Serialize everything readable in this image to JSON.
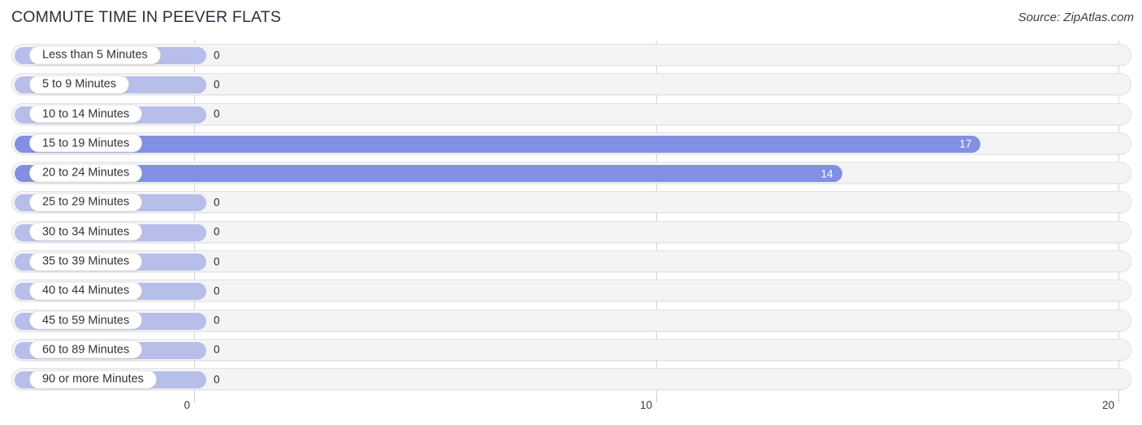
{
  "header": {
    "title": "COMMUTE TIME IN PEEVER FLATS",
    "source": "Source: ZipAtlas.com"
  },
  "colors": {
    "bar_fill": "#8190e2",
    "bar_zero_fill": "#b7beea",
    "track_bg": "#f4f4f6",
    "gridline": "#d6d6d6",
    "label_bg": "#ffffff",
    "value_inside_text": "#ffffff",
    "value_outside_text": "#2b2b2b",
    "title_text": "#2b2f3a"
  },
  "chart_data": {
    "type": "bar",
    "orientation": "horizontal",
    "title": "COMMUTE TIME IN PEEVER FLATS",
    "subtitle": "",
    "xlabel": "",
    "ylabel": "",
    "xlim": [
      0,
      20
    ],
    "grid": true,
    "legend": null,
    "source": "Source: ZipAtlas.com",
    "x_ticks": [
      "0",
      "10",
      "20"
    ],
    "x_tick_values": [
      0,
      10,
      20
    ],
    "categories": [
      "Less than 5 Minutes",
      "5 to 9 Minutes",
      "10 to 14 Minutes",
      "15 to 19 Minutes",
      "20 to 24 Minutes",
      "25 to 29 Minutes",
      "30 to 34 Minutes",
      "35 to 39 Minutes",
      "40 to 44 Minutes",
      "45 to 59 Minutes",
      "60 to 89 Minutes",
      "90 or more Minutes"
    ],
    "values": [
      0,
      0,
      0,
      17,
      14,
      0,
      0,
      0,
      0,
      0,
      0,
      0
    ],
    "value_labels": [
      "0",
      "0",
      "0",
      "17",
      "14",
      "0",
      "0",
      "0",
      "0",
      "0",
      "0",
      "0"
    ]
  }
}
